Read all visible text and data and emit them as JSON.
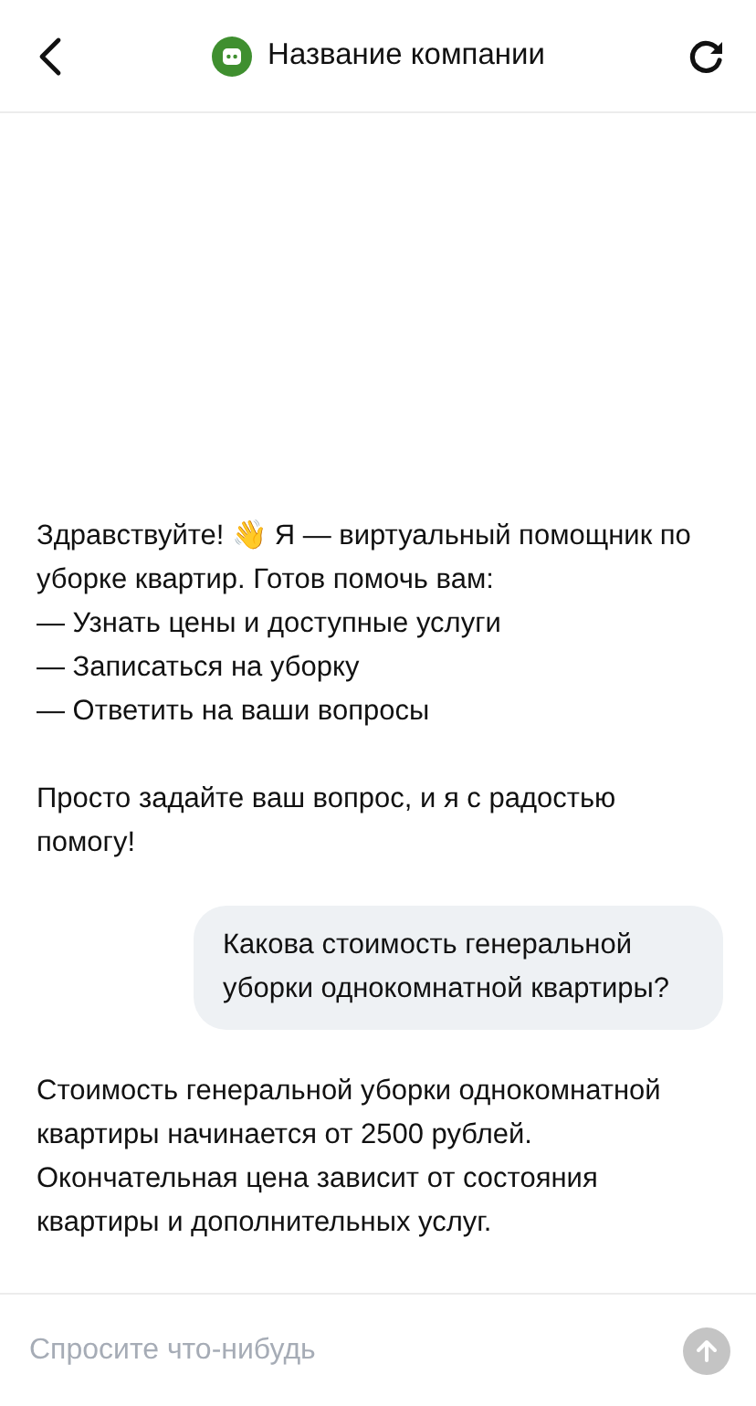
{
  "header": {
    "title": "Название компании"
  },
  "messages": [
    {
      "kind": "bot",
      "text": "Здравствуйте! 👋 Я — виртуальный помощник по уборке квартир. Готов помочь вам:\n— Узнать цены и доступные услуги\n— Записаться на уборку\n— Ответить на ваши вопросы\n\nПросто задайте ваш вопрос, и я с радостью помогу!"
    },
    {
      "kind": "user",
      "text": "Какова стоимость генеральной уборки однокомнатной квартиры?"
    },
    {
      "kind": "bot",
      "text": "Стоимость генеральной уборки однокомнатной квартиры начинается от 2500 рублей. Окончательная цена зависит от состояния квартиры и дополнительных услуг."
    }
  ],
  "composer": {
    "placeholder": "Спросите что-нибудь",
    "send_disabled": true
  }
}
